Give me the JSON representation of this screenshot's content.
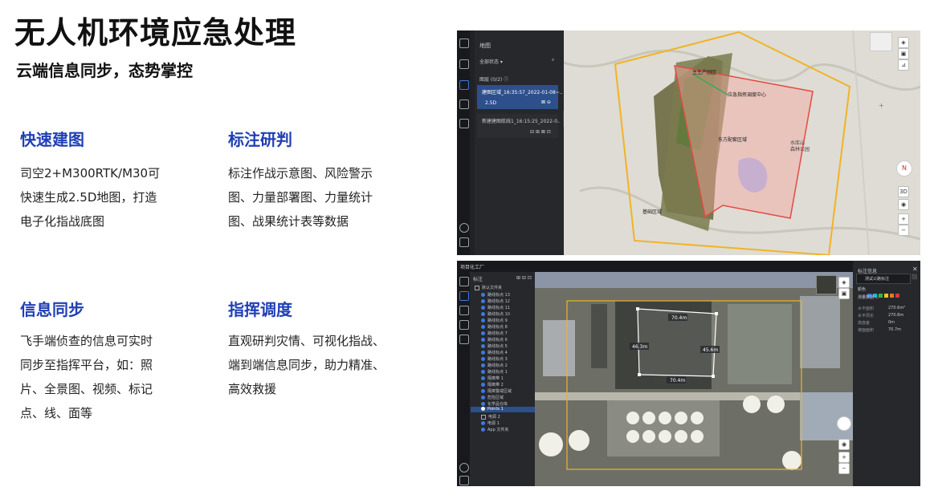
{
  "title": "无人机环境应急处理",
  "subtitle": "云端信息同步，态势掌控",
  "features": [
    {
      "heading": "快速建图",
      "lines": [
        "司空2+M300RTK/M30可",
        "快速生成2.5D地图，打造",
        "电子化指战底图"
      ]
    },
    {
      "heading": "标注研判",
      "lines": [
        "标注作战示意图、风险警示",
        "图、力量部署图、力量统计",
        "图、战果统计表等数据"
      ]
    },
    {
      "heading": "信息同步",
      "lines": [
        "飞手端侦查的信息可实时",
        "同步至指挥平台，如：照",
        "片、全景图、视频、标记",
        "点、线、面等"
      ]
    },
    {
      "heading": "指挥调度",
      "lines": [
        "直观研判灾情、可视化指战、",
        "端到端信息同步，助力精准、",
        "高效救援"
      ]
    }
  ],
  "shot_top": {
    "panel_title": "地图",
    "filter_label": "全部状态 ▾",
    "section_label": "图层 (0/2) ⓘ",
    "items": [
      {
        "name": "建图区域_16:35:57_2022-01-08~..",
        "sub": "2.5D"
      },
      {
        "name": "新建建图航线1_16:15:25_2022-0..",
        "sub": ""
      }
    ],
    "map_labels": [
      "主生产园区",
      "应急指挥调度中心",
      "东方配套区域",
      "水库山",
      "森林公园",
      "基础区域"
    ],
    "compass_label": "N",
    "view_label": "3D",
    "zoom_in": "+",
    "zoom_out": "−"
  },
  "shot_bottom": {
    "window_title": "项目化工厂",
    "tree_title": "标注",
    "tree_items": [
      "默认文件夹",
      "路线标点 13",
      "路线标点 12",
      "路线标点 11",
      "路线标点 10",
      "路线标点 9",
      "路线标点 8",
      "路线标点 7",
      "路线标点 6",
      "路线标点 5",
      "路线标点 4",
      "路线标点 3",
      "路线标点 2",
      "路线标点 1",
      "隔离带 1",
      "隔离带 2",
      "隔离警戒区域",
      "危险区域",
      "化学品仓库",
      "Points 1",
      "电源 2",
      "电源 1",
      "App 文件夹"
    ],
    "detail_title": "标注信息",
    "detail_name": "测试公路标注",
    "detail_color_label": "颜色",
    "detail_section": "测量数据 ⓘ",
    "detail_rows": [
      {
        "k": "水平面积",
        "v": "270.6m²"
      },
      {
        "k": "水平周长",
        "v": "270.8m"
      },
      {
        "k": "高度差",
        "v": "0m"
      },
      {
        "k": "坡面面积",
        "v": "70.7m"
      }
    ],
    "measure_labels": [
      "70.4m",
      "45.6m",
      "70.4m",
      "46.3m"
    ]
  }
}
